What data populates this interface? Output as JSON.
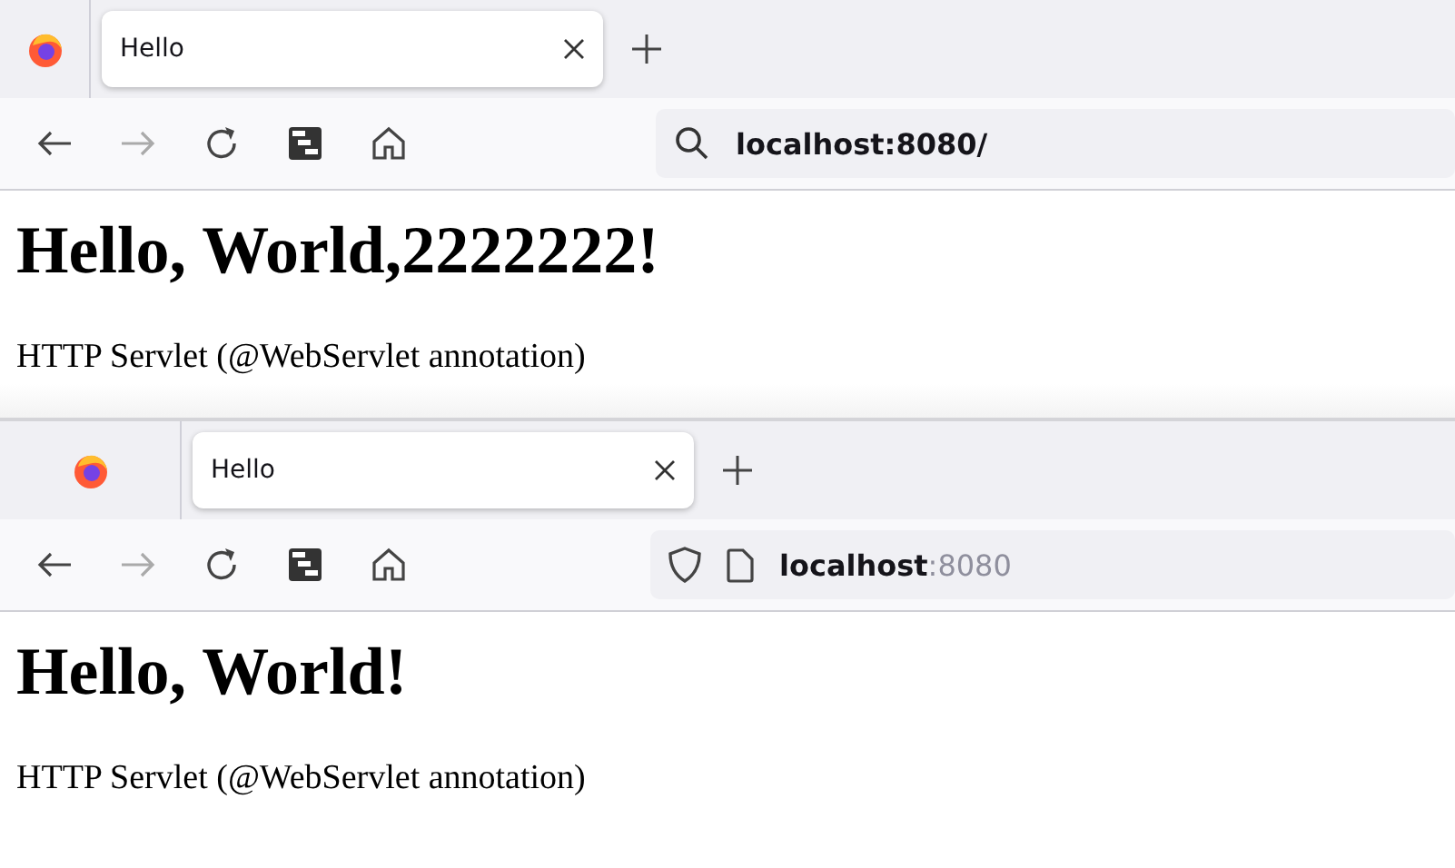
{
  "windows": [
    {
      "tab": {
        "title": "Hello",
        "selected": true
      },
      "address": {
        "icons": [
          {
            "kind": "search"
          }
        ],
        "parts": [
          {
            "text": "localhost:8080/",
            "dim": false
          }
        ]
      },
      "heading": "Hello, World,2222222!",
      "paragraph": "HTTP Servlet (@WebServlet annotation)"
    },
    {
      "tab": {
        "title": "Hello",
        "selected": true
      },
      "address": {
        "icons": [
          {
            "kind": "shield"
          },
          {
            "kind": "page"
          }
        ],
        "parts": [
          {
            "text": "localhost",
            "dim": false
          },
          {
            "text": ":8080",
            "dim": true
          }
        ]
      },
      "heading": "Hello, World!",
      "paragraph": "HTTP Servlet (@WebServlet annotation)"
    }
  ]
}
